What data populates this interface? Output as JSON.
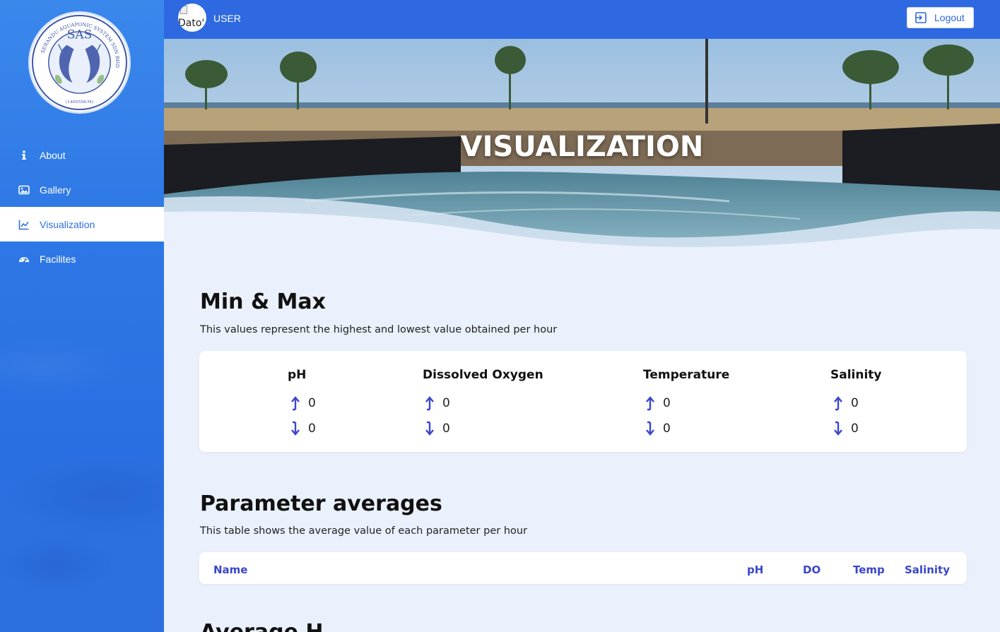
{
  "sidebar": {
    "logo": {
      "text": "SAS",
      "ring_text": "SERANDU AQUAPONIC SYSTEM SDN BHD",
      "reg_no": "1405558-M"
    },
    "items": [
      {
        "label": "About",
        "icon": "info-icon",
        "active": false
      },
      {
        "label": "Gallery",
        "icon": "image-icon",
        "active": false
      },
      {
        "label": "Visualization",
        "icon": "chart-line-icon",
        "active": true
      },
      {
        "label": "Facilites",
        "icon": "tachometer-icon",
        "active": false
      }
    ]
  },
  "topbar": {
    "avatar_alt": "Dato'",
    "username": "USER",
    "logout_label": "Logout"
  },
  "hero": {
    "title": "VISUALIZATION"
  },
  "minmax": {
    "title": "Min & Max",
    "description": "This values represent the highest and lowest value obtained per hour",
    "params": [
      {
        "name": "pH",
        "max": "0",
        "min": "0"
      },
      {
        "name": "Dissolved Oxygen",
        "max": "0",
        "min": "0"
      },
      {
        "name": "Temperature",
        "max": "0",
        "min": "0"
      },
      {
        "name": "Salinity",
        "max": "0",
        "min": "0"
      }
    ]
  },
  "averages": {
    "title": "Parameter averages",
    "description": "This table shows the average value of each parameter per hour",
    "columns": [
      "Name",
      "pH",
      "DO",
      "Temp",
      "Salinity"
    ]
  },
  "next_section": {
    "title": "Average H"
  },
  "colors": {
    "primary": "#2e69e1",
    "sidebar": "#2f78e6",
    "table_header": "#3a46c9",
    "background": "#eaf1fc"
  }
}
